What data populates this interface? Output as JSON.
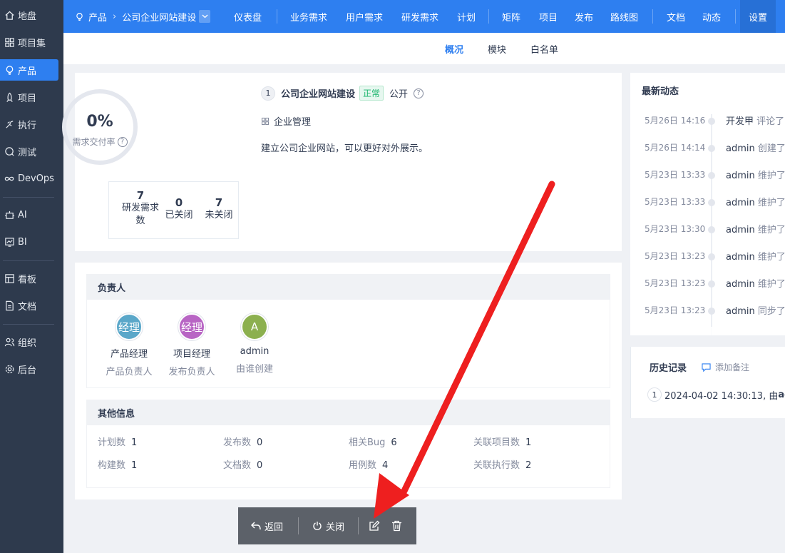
{
  "sidebar": {
    "items": [
      {
        "label": "地盘",
        "icon": "home-icon"
      },
      {
        "label": "项目集",
        "icon": "grid-icon"
      },
      {
        "label": "产品",
        "icon": "lightbulb-icon"
      },
      {
        "label": "项目",
        "icon": "rocket-icon"
      },
      {
        "label": "执行",
        "icon": "run-icon"
      },
      {
        "label": "测试",
        "icon": "search-bug-icon"
      },
      {
        "label": "DevOps",
        "icon": "infinity-icon"
      },
      {
        "label": "AI",
        "icon": "robot-icon"
      },
      {
        "label": "BI",
        "icon": "chart-icon"
      },
      {
        "label": "看板",
        "icon": "kanban-icon"
      },
      {
        "label": "文档",
        "icon": "doc-icon"
      },
      {
        "label": "组织",
        "icon": "users-icon"
      },
      {
        "label": "后台",
        "icon": "gear-icon"
      }
    ]
  },
  "topbar": {
    "crumb_root": "产品",
    "crumb_product": "公司企业网站建设",
    "links": [
      "仪表盘",
      "业务需求",
      "用户需求",
      "研发需求",
      "计划",
      "矩阵",
      "项目",
      "发布",
      "路线图",
      "文档",
      "动态"
    ],
    "settings": "设置"
  },
  "subnav": {
    "tabs": [
      "概况",
      "模块",
      "白名单"
    ]
  },
  "overview": {
    "progress_value": 0,
    "progress_text": "0%",
    "progress_label": "需求交付率",
    "stats": [
      {
        "num": "7",
        "label": "研发需求数"
      },
      {
        "num": "0",
        "label": "已关闭"
      },
      {
        "num": "7",
        "label": "未关闭"
      }
    ],
    "product_id": "1",
    "product_name": "公司企业网站建设",
    "status": "正常",
    "acl": "公开",
    "program": "企业管理",
    "description": "建立公司企业网站，可以更好对外展示。"
  },
  "owners": {
    "title": "负责人",
    "people": [
      {
        "avatar": "经理",
        "name": "产品经理",
        "role": "产品负责人",
        "color": "#5aa7c9"
      },
      {
        "avatar": "经理",
        "name": "项目经理",
        "role": "发布负责人",
        "color": "#b865c4"
      },
      {
        "avatar": "A",
        "name": "admin",
        "role": "由谁创建",
        "color": "#8cb04f"
      }
    ]
  },
  "other_info": {
    "title": "其他信息",
    "items": [
      {
        "label": "计划数",
        "value": "1"
      },
      {
        "label": "发布数",
        "value": "0"
      },
      {
        "label": "相关Bug",
        "value": "6"
      },
      {
        "label": "关联项目数",
        "value": "1"
      },
      {
        "label": "构建数",
        "value": "1"
      },
      {
        "label": "文档数",
        "value": "0"
      },
      {
        "label": "用例数",
        "value": "4"
      },
      {
        "label": "关联执行数",
        "value": "2"
      }
    ]
  },
  "dynamics": {
    "title": "最新动态",
    "rows": [
      {
        "time": "5月26日 14:16",
        "user": "开发甲",
        "action": "评论了"
      },
      {
        "time": "5月26日 14:14",
        "user": "admin",
        "action": "创建了"
      },
      {
        "time": "5月23日 13:33",
        "user": "admin",
        "action": "维护了"
      },
      {
        "time": "5月23日 13:33",
        "user": "admin",
        "action": "维护了"
      },
      {
        "time": "5月23日 13:30",
        "user": "admin",
        "action": "维护了"
      },
      {
        "time": "5月23日 13:23",
        "user": "admin",
        "action": "维护了"
      },
      {
        "time": "5月23日 13:23",
        "user": "admin",
        "action": "维护了"
      },
      {
        "time": "5月23日 13:23",
        "user": "admin",
        "action": "同步了"
      }
    ]
  },
  "history": {
    "title": "历史记录",
    "add_note": "添加备注",
    "entries": [
      {
        "index": "1",
        "text": "2024-04-02 14:30:13, 由 ",
        "user": "adm"
      }
    ]
  },
  "toolbar": {
    "back": "返回",
    "close": "关闭"
  }
}
